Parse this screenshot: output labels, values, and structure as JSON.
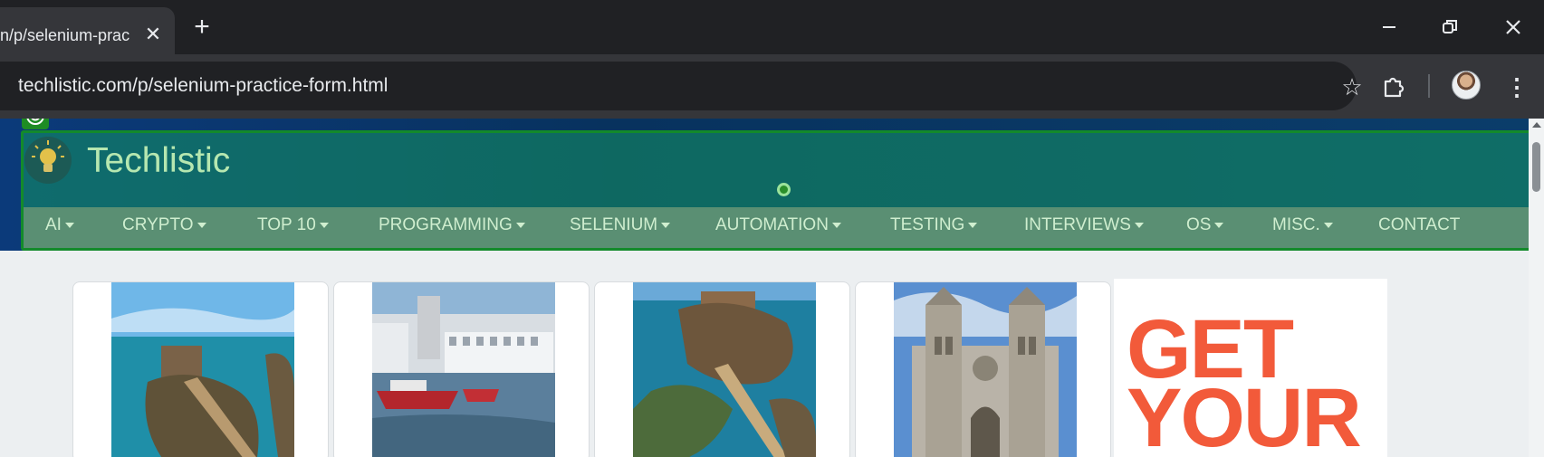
{
  "browser": {
    "tab_title": "n/p/selenium-prac",
    "close_symbol": "✕",
    "new_tab_symbol": "+",
    "url": "techlistic.com/p/selenium-practice-form.html",
    "star_symbol": "☆",
    "menu_symbol": "⋮",
    "icons": [
      "close-icon",
      "new-tab-icon",
      "minimize-icon",
      "restore-icon",
      "window-close-icon",
      "bookmark-star-icon",
      "extensions-icon",
      "profile-avatar",
      "more-menu-icon"
    ]
  },
  "site": {
    "brand": "Techlistic",
    "nav": [
      {
        "label": "AI",
        "caret": true
      },
      {
        "label": "CRYPTO",
        "caret": true
      },
      {
        "label": "TOP 10",
        "caret": true
      },
      {
        "label": "PROGRAMMING",
        "caret": true
      },
      {
        "label": "SELENIUM",
        "caret": true
      },
      {
        "label": "AUTOMATION",
        "caret": true
      },
      {
        "label": "TESTING",
        "caret": true
      },
      {
        "label": "INTERVIEWS",
        "caret": true
      },
      {
        "label": "OS",
        "caret": true
      },
      {
        "label": "MISC.",
        "caret": true
      },
      {
        "label": "CONTACT",
        "caret": false
      }
    ],
    "gallery": [
      {
        "name": "sea-fort-bridge-photo"
      },
      {
        "name": "harbor-town-photo"
      },
      {
        "name": "island-fort-photo"
      },
      {
        "name": "cathedral-photo"
      }
    ],
    "ad": {
      "line1": "GET",
      "line2": "YOUR",
      "color": "#f25a3a"
    }
  },
  "colors": {
    "highlight_border": "#138a2b",
    "nav_text": "#cfeecf",
    "brand_text": "#b6e7b0"
  }
}
